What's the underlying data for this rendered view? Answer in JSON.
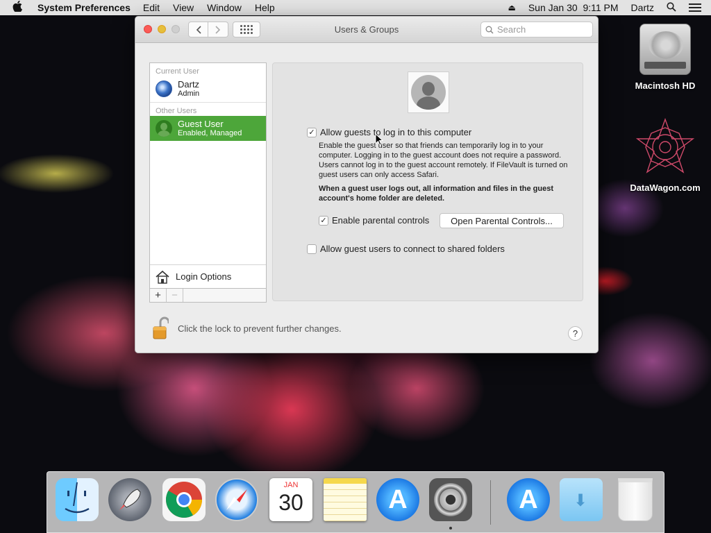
{
  "menubar": {
    "apple_icon": "apple-logo",
    "app_name": "System Preferences",
    "menus": [
      "Edit",
      "View",
      "Window",
      "Help"
    ],
    "datetime": "Sun Jan 30  9:11 PM",
    "user": "Dartz"
  },
  "desktop": {
    "icons": [
      {
        "label": "Macintosh HD",
        "icon": "hard-drive-icon"
      },
      {
        "label": "DataWagon.com",
        "icon": "star-logo-icon"
      }
    ]
  },
  "window": {
    "title": "Users & Groups",
    "search_placeholder": "Search",
    "sidebar": {
      "current_user_label": "Current User",
      "current_user": {
        "name": "Dartz",
        "role": "Admin"
      },
      "other_users_label": "Other Users",
      "other_users": [
        {
          "name": "Guest User",
          "status": "Enabled, Managed",
          "selected": true
        }
      ],
      "login_options_label": "Login Options",
      "add_label": "+",
      "remove_label": "−"
    },
    "guest_panel": {
      "allow_guests_label": "Allow guests to log in to this computer",
      "allow_guests_checked": true,
      "description": "Enable the guest user so that friends can temporarily log in to your computer. Logging in to the guest account does not require a password. Users cannot log in to the guest account remotely. If FileVault is turned on guest users can only access Safari.",
      "warning": "When a guest user logs out, all information and files in the guest account's home folder are deleted.",
      "parental_controls_label": "Enable parental controls",
      "parental_controls_checked": true,
      "open_parental_button": "Open Parental Controls...",
      "shared_folders_label": "Allow guest users to connect to shared folders",
      "shared_folders_checked": false,
      "check_mark": "✓"
    },
    "lock_text": "Click the lock to prevent further changes.",
    "help_label": "?"
  },
  "dock": {
    "apps": [
      "Finder",
      "Launchpad",
      "Google Chrome",
      "Safari",
      "Calendar",
      "Notes",
      "App Store",
      "System Preferences",
      "App Store Download",
      "Downloads",
      "Trash"
    ],
    "calendar_month": "JAN",
    "calendar_day": "30",
    "app_store_glyph": "A"
  },
  "colors": {
    "selection_green": "#4da63a",
    "close_red": "#fc5b57",
    "minimize_yellow": "#e5bf3c"
  }
}
